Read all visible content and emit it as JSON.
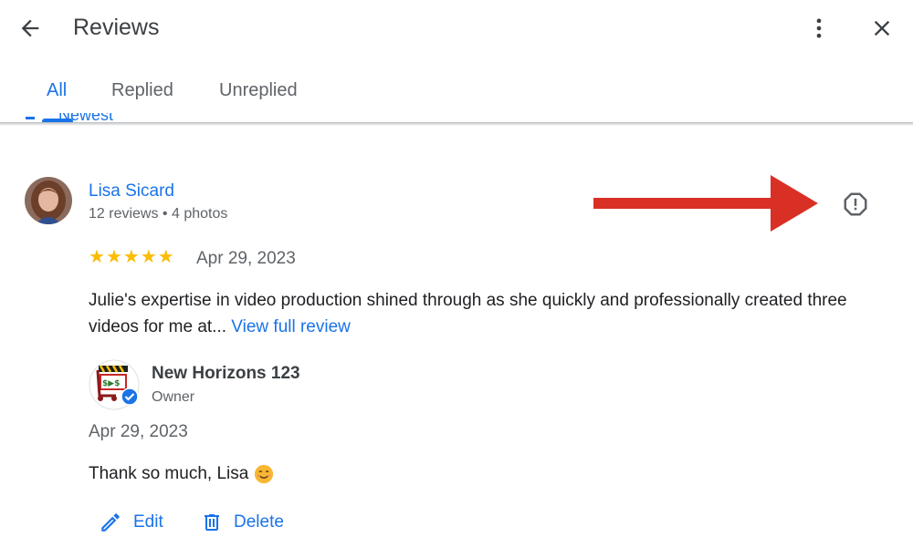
{
  "header": {
    "title": "Reviews",
    "back_icon": "arrow-back-icon",
    "more_icon": "more-vert-icon",
    "close_icon": "close-icon"
  },
  "tabs": [
    {
      "label": "All",
      "active": true
    },
    {
      "label": "Replied",
      "active": false
    },
    {
      "label": "Unreplied",
      "active": false
    }
  ],
  "sort": {
    "label": "Newest"
  },
  "review": {
    "reviewer_name": "Lisa Sicard",
    "reviewer_meta": "12 reviews • 4 photos",
    "rating": 5,
    "date": "Apr 29, 2023",
    "text": "Julie's expertise in video production shined through as she quickly and professionally created three videos for me at... ",
    "view_full_label": "View full review",
    "report_icon": "report-icon"
  },
  "reply": {
    "owner_name": "New Horizons 123",
    "owner_role": "Owner",
    "date": "Apr 29, 2023",
    "text": "Thank so much, Lisa",
    "emoji": "smiling-face-emoji"
  },
  "actions": {
    "edit_label": "Edit",
    "delete_label": "Delete"
  },
  "colors": {
    "accent": "#1a73e8",
    "star": "#fbbc04",
    "annotation_arrow": "#d93025"
  }
}
